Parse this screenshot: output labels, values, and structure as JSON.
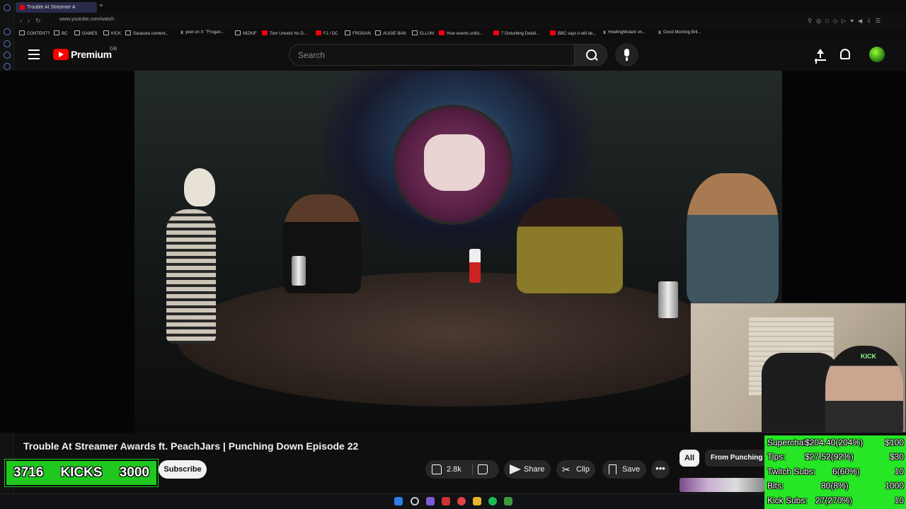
{
  "browser": {
    "tab_title": "Trouble At Streamer A",
    "url": "www.youtube.com/watch",
    "bookmarks": [
      "CONTENT?",
      "BC",
      "GAMES",
      "KICK",
      "Sarasota content...",
      "yeet on X: \"Frogan...",
      "MIZKIF",
      "Tom Unveils his D...",
      "FJ / DC",
      "FROGAN",
      "AUGIE BAN",
      "ELLUM",
      "How events unfol...",
      "7 Disturbing Detail...",
      "BBC says it will de...",
      "HowlingMutant on...",
      "Good Morning Brit..."
    ]
  },
  "header": {
    "logo_text": "Premium",
    "logo_region": "GB",
    "search_placeholder": "Search"
  },
  "video": {
    "title": "Trouble At Streamer Awards ft. PeachJars | Punching Down Episode 22",
    "webcam_cap_text": "KICK"
  },
  "actions": {
    "like_count": "2.8k",
    "share_label": "Share",
    "clip_label": "Clip",
    "save_label": "Save",
    "subscribe_label": "Subscribe",
    "more_label": "•••"
  },
  "chips": {
    "all": "All",
    "from": "From Punching"
  },
  "kicks": {
    "current": "3716",
    "label": "KICKS",
    "goal": "3000"
  },
  "stats": [
    {
      "label": "Superchats:",
      "value": "$204.40(204%)",
      "goal": "$100"
    },
    {
      "label": "Tips:",
      "value": "$27.52(92%)",
      "goal": "$30"
    },
    {
      "label": "Twitch Subs:",
      "value": "6(60%)",
      "goal": "10"
    },
    {
      "label": "Bits:",
      "value": "80(8%)",
      "goal": "1000"
    },
    {
      "label": "Kick Subs:",
      "value": "27(270%)",
      "goal": "10"
    }
  ]
}
